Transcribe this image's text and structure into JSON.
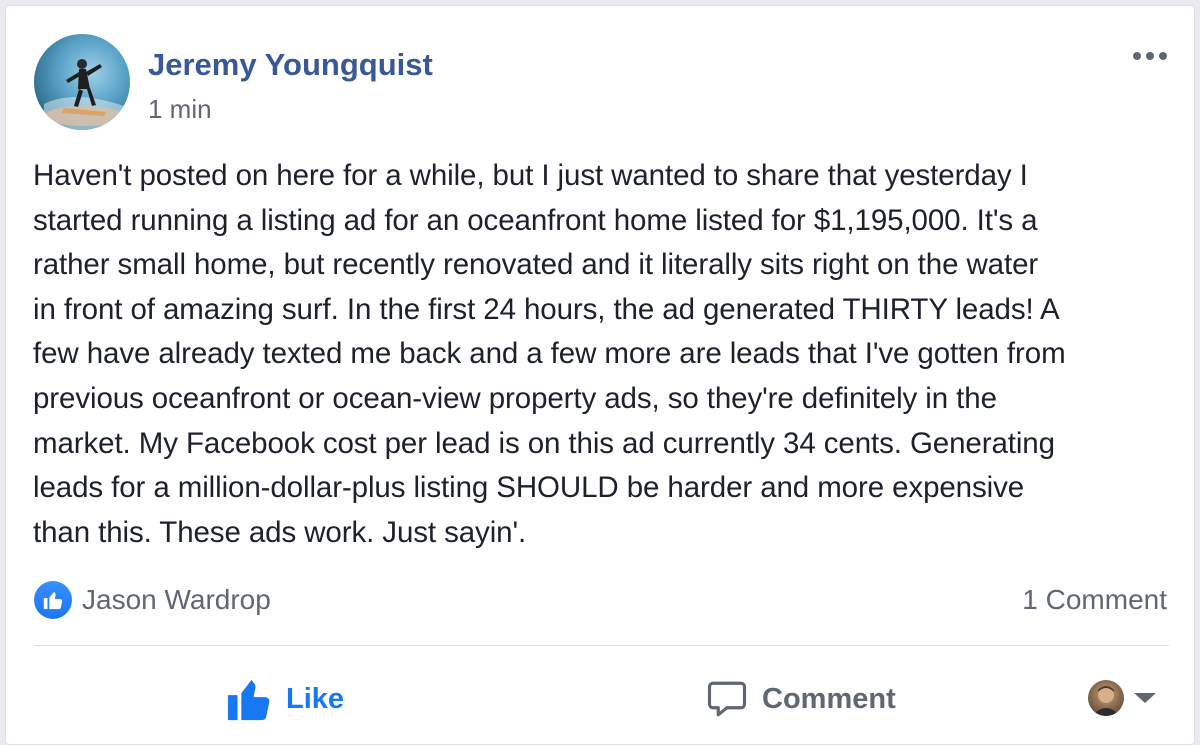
{
  "post": {
    "author": "Jeremy Youngquist",
    "timestamp": "1 min",
    "body": "Haven't posted on here for a while, but I just wanted to share that yesterday I\nstarted running a listing ad for an oceanfront home listed for $1,195,000. It's a\nrather small home, but recently renovated and it literally sits right on the water\nin front of amazing surf. In the first 24 hours, the ad generated THIRTY leads! A\nfew have already texted me back and a few more are leads that I've gotten from\nprevious oceanfront or ocean-view property ads, so they're definitely in the\nmarket. My Facebook cost per lead is on this ad currently 34 cents. Generating\nleads for a million-dollar-plus listing SHOULD be harder and more expensive\nthan this. These ads work. Just sayin'."
  },
  "reactions": {
    "reactor": "Jason Wardrop",
    "comment_count": "1 Comment"
  },
  "actions": {
    "like_label": "Like",
    "comment_label": "Comment"
  },
  "colors": {
    "author_link": "#385898",
    "like_blue": "#1877f2",
    "secondary_text": "#606770",
    "body_text": "#1d2129"
  },
  "icons": {
    "more": "more-options-icon",
    "like_badge": "thumbs-up-icon",
    "like_action": "thumbs-up-icon",
    "comment_action": "speech-bubble-icon",
    "share_as": "caret-down-icon"
  }
}
